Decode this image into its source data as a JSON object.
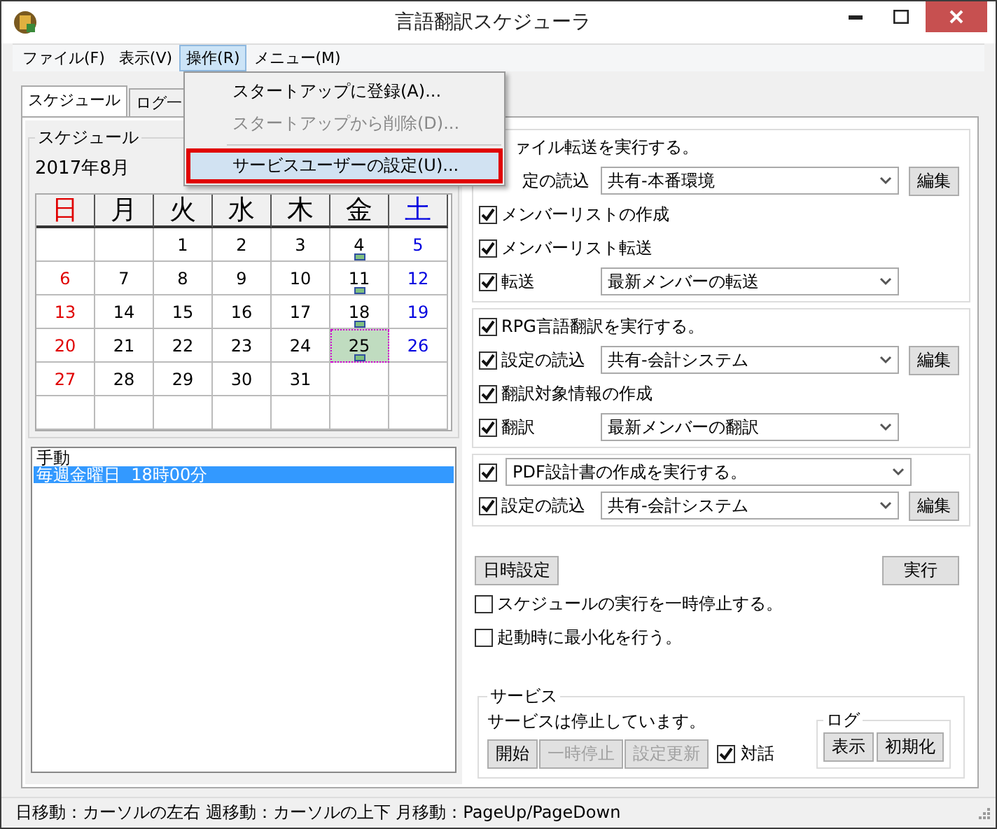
{
  "window": {
    "title": "言語翻訳スケジューラ"
  },
  "menubar": [
    {
      "label": "ファイル(F)",
      "selected": false
    },
    {
      "label": "表示(V)",
      "selected": false
    },
    {
      "label": "操作(R)",
      "selected": true
    },
    {
      "label": "メニュー(M)",
      "selected": false
    }
  ],
  "menu": {
    "items": [
      {
        "label": "スタートアップに登録(A)...",
        "disabled": false,
        "selected": false
      },
      {
        "label": "スタートアップから削除(D)...",
        "disabled": true,
        "selected": false
      },
      {
        "kind": "separator"
      },
      {
        "label": "サービスユーザーの設定(U)...",
        "disabled": false,
        "selected": true
      }
    ]
  },
  "tabs": [
    {
      "label": "スケジュール",
      "selected": true
    },
    {
      "label": "ログ一",
      "selected": false
    }
  ],
  "calendar": {
    "group_title": "スケジュール",
    "month": "2017年8月",
    "weekdays": [
      {
        "label": "日",
        "kind": "sunday"
      },
      {
        "label": "月",
        "kind": "weekday"
      },
      {
        "label": "火",
        "kind": "weekday"
      },
      {
        "label": "水",
        "kind": "weekday"
      },
      {
        "label": "木",
        "kind": "weekday"
      },
      {
        "label": "金",
        "kind": "weekday"
      },
      {
        "label": "土",
        "kind": "saturday"
      }
    ],
    "weeks": [
      [
        {
          "kind": "empty"
        },
        {
          "kind": "empty"
        },
        {
          "day": "1",
          "kind": "weekday"
        },
        {
          "day": "2",
          "kind": "weekday"
        },
        {
          "day": "3",
          "kind": "weekday"
        },
        {
          "day": "4",
          "kind": "weekday",
          "marker": true,
          "selected": false
        },
        {
          "day": "5",
          "kind": "saturday"
        }
      ],
      [
        {
          "day": "6",
          "kind": "sunday"
        },
        {
          "day": "7",
          "kind": "weekday"
        },
        {
          "day": "8",
          "kind": "weekday"
        },
        {
          "day": "9",
          "kind": "weekday"
        },
        {
          "day": "10",
          "kind": "weekday"
        },
        {
          "day": "11",
          "kind": "weekday",
          "marker": true,
          "selected": false
        },
        {
          "day": "12",
          "kind": "saturday"
        }
      ],
      [
        {
          "day": "13",
          "kind": "sunday"
        },
        {
          "day": "14",
          "kind": "weekday"
        },
        {
          "day": "15",
          "kind": "weekday"
        },
        {
          "day": "16",
          "kind": "weekday"
        },
        {
          "day": "17",
          "kind": "weekday"
        },
        {
          "day": "18",
          "kind": "weekday",
          "marker": true,
          "selected": false
        },
        {
          "day": "19",
          "kind": "saturday"
        }
      ],
      [
        {
          "day": "20",
          "kind": "sunday"
        },
        {
          "day": "21",
          "kind": "weekday"
        },
        {
          "day": "22",
          "kind": "weekday"
        },
        {
          "day": "23",
          "kind": "weekday"
        },
        {
          "day": "24",
          "kind": "weekday"
        },
        {
          "day": "25",
          "kind": "weekday",
          "marker": true,
          "selected": true
        },
        {
          "day": "26",
          "kind": "saturday"
        }
      ],
      [
        {
          "day": "27",
          "kind": "sunday"
        },
        {
          "day": "28",
          "kind": "weekday"
        },
        {
          "day": "29",
          "kind": "weekday"
        },
        {
          "day": "30",
          "kind": "weekday"
        },
        {
          "day": "31",
          "kind": "weekday"
        },
        {
          "kind": "empty"
        },
        {
          "kind": "empty"
        }
      ],
      [
        {
          "kind": "empty"
        },
        {
          "kind": "empty"
        },
        {
          "kind": "empty"
        },
        {
          "kind": "empty"
        },
        {
          "kind": "empty"
        },
        {
          "kind": "empty"
        },
        {
          "kind": "empty"
        }
      ]
    ]
  },
  "schedule_list": {
    "items": [
      {
        "label": "手動",
        "selected": false
      },
      {
        "label": "毎週金曜日  18時00分",
        "selected": true
      }
    ]
  },
  "task_groups": [
    {
      "kind": "plain",
      "title": "ァイル転送を実行する。",
      "rows": [
        {
          "kind": "select",
          "label": "定の読込",
          "value": "共有-本番環境",
          "edit": "編集"
        },
        {
          "kind": "check",
          "label": "メンバーリストの作成",
          "checked": true
        },
        {
          "kind": "check",
          "label": "メンバーリスト転送",
          "checked": true
        },
        {
          "kind": "select",
          "label": "転送",
          "checked": true,
          "value": "最新メンバーの転送"
        }
      ]
    },
    {
      "kind": "check",
      "title": "RPG言語翻訳を実行する。",
      "checked": true,
      "rows": [
        {
          "kind": "select",
          "label": "設定の読込",
          "checked": true,
          "value": "共有-会計システム",
          "edit": "編集"
        },
        {
          "kind": "check",
          "label": "翻訳対象情報の作成",
          "checked": true
        },
        {
          "kind": "select",
          "label": "翻訳",
          "checked": true,
          "value": "最新メンバーの翻訳"
        }
      ]
    },
    {
      "kind": "select",
      "title": "PDF設計書の作成を実行する。",
      "checked": true,
      "rows": [
        {
          "kind": "select",
          "label": "設定の読込",
          "checked": true,
          "value": "共有-会計システム",
          "edit": "編集"
        }
      ]
    }
  ],
  "datetime_button": "日時設定",
  "run_button": "実行",
  "options": [
    {
      "label": "スケジュールの実行を一時停止する。",
      "checked": false
    },
    {
      "label": "起動時に最小化を行う。",
      "checked": false
    }
  ],
  "service": {
    "title": "サービス",
    "status": "サービスは停止しています。",
    "buttons": [
      {
        "label": "開始",
        "disabled": false
      },
      {
        "label": "一時停止",
        "disabled": true
      },
      {
        "label": "設定更新",
        "disabled": true
      }
    ],
    "dialog": {
      "label": "対話",
      "checked": true
    },
    "log": {
      "title": "ログ",
      "buttons": [
        {
          "label": "表示",
          "disabled": false
        },
        {
          "label": "初期化",
          "disabled": false
        }
      ]
    }
  },
  "status_bar": "日移動：カーソルの左右  週移動：カーソルの上下  月移動：PageUp/PageDown"
}
